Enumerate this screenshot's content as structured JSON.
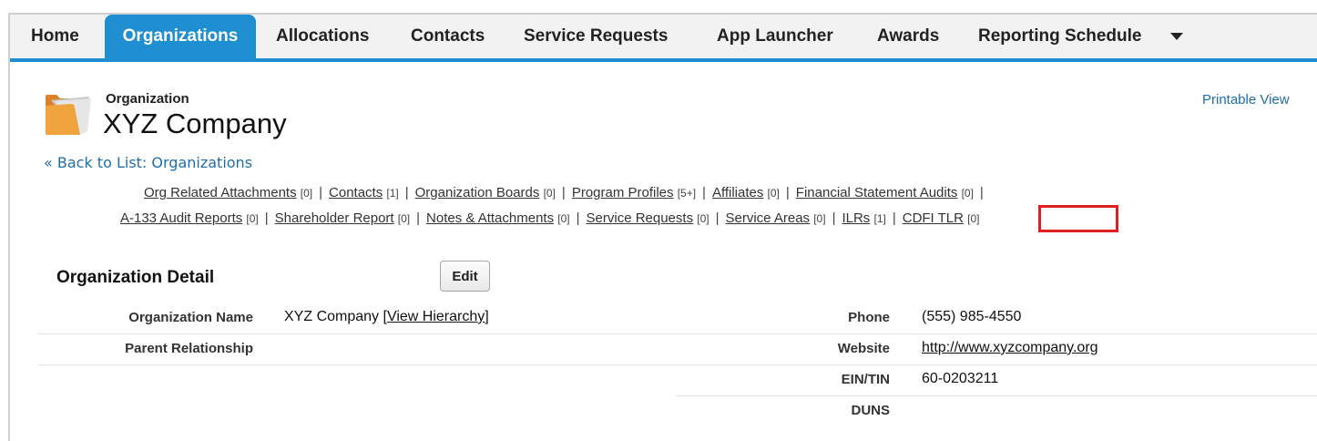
{
  "tabs": [
    {
      "label": "Home",
      "active": false
    },
    {
      "label": "Organizations",
      "active": true
    },
    {
      "label": "Allocations",
      "active": false
    },
    {
      "label": "Contacts",
      "active": false
    },
    {
      "label": "Service Requests",
      "active": false
    },
    {
      "label": "App Launcher",
      "active": false
    },
    {
      "label": "Awards",
      "active": false
    },
    {
      "label": "Reporting Schedule",
      "active": false
    }
  ],
  "header": {
    "object_type": "Organization",
    "record_name": "XYZ Company",
    "printable_view": "Printable View",
    "back_link": "« Back to List: Organizations"
  },
  "related_lists": {
    "row1": [
      {
        "label": "Org Related Attachments",
        "count": "[0]"
      },
      {
        "label": "Contacts",
        "count": "[1]"
      },
      {
        "label": "Organization Boards",
        "count": "[0]"
      },
      {
        "label": "Program Profiles",
        "count": "[5+]"
      },
      {
        "label": "Affiliates",
        "count": "[0]"
      },
      {
        "label": "Financial Statement Audits",
        "count": "[0]"
      }
    ],
    "row2": [
      {
        "label": "A-133 Audit Reports",
        "count": "[0]"
      },
      {
        "label": "Shareholder Report",
        "count": "[0]"
      },
      {
        "label": "Notes & Attachments",
        "count": "[0]"
      },
      {
        "label": "Service Requests",
        "count": "[0]"
      },
      {
        "label": "Service Areas",
        "count": "[0]"
      },
      {
        "label": "ILRs",
        "count": "[1]"
      },
      {
        "label": "CDFI TLR",
        "count": "[0]"
      }
    ],
    "separator": "|",
    "highlight_color": "#e02020"
  },
  "detail": {
    "title": "Organization Detail",
    "edit_label": "Edit",
    "org_name_label": "Organization Name",
    "org_name_value": "XYZ Company",
    "view_hierarchy_open": "[",
    "view_hierarchy": "View Hierarchy",
    "view_hierarchy_close": "]",
    "parent_label": "Parent Relationship",
    "phone_label": "Phone",
    "phone_value": "(555) 985-4550",
    "website_label": "Website",
    "website_value": "http://www.xyzcompany.org",
    "ein_label": "EIN/TIN",
    "ein_value": "60-0203211",
    "duns_label": "DUNS"
  },
  "colors": {
    "accent": "#1f8fd1",
    "link": "#1f6ea8"
  }
}
